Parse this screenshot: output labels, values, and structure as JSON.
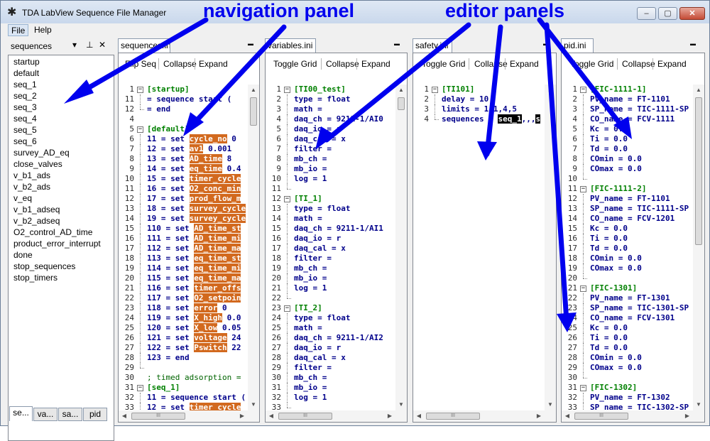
{
  "window": {
    "title": "TDA LabView Sequence File Manager",
    "min": "–",
    "max": "▢",
    "close": "✕"
  },
  "menu": {
    "file": "File",
    "help": "Help"
  },
  "nav": {
    "title": "sequences",
    "dropdown": "▾",
    "pin": "⊥",
    "close": "✕",
    "items": [
      "startup",
      "default",
      "seq_1",
      "seq_2",
      "seq_3",
      "seq_4",
      "seq_5",
      "seq_6",
      "survey_AD_eq",
      "close_valves",
      "v_b1_ads",
      "v_b2_ads",
      "v_eq",
      "v_b1_adseq",
      "v_b2_adseq",
      "O2_control_AD_time",
      "product_error_interrupt",
      "done",
      "stop_sequences",
      "stop_timers"
    ],
    "tabs": [
      "se...",
      "va...",
      "sa...",
      "pid"
    ]
  },
  "annotations": {
    "nav": "navigation panel",
    "editor": "editor panels"
  },
  "panels": [
    {
      "tab": "sequences.ini",
      "toolbar": [
        "Flip Seq",
        "Collapse",
        "Expand"
      ],
      "lines": [
        {
          "n": "1",
          "t": "[startup]",
          "f": "box",
          "h": true
        },
        {
          "n": "11",
          "t": "= sequence start (",
          "f": "line"
        },
        {
          "n": "12",
          "t": "= end",
          "f": "end"
        },
        {
          "n": "4",
          "t": "",
          "f": ""
        },
        {
          "n": "5",
          "t": "[default]",
          "f": "box",
          "h": true
        },
        {
          "n": "6",
          "t": "11 = set ",
          "hl": "cycle_no",
          " r": "",
          "tail": " 0",
          "f": "line"
        },
        {
          "n": "7",
          "t": "12 = set ",
          "hl": "av1",
          "tail": " 0.001",
          "f": "line"
        },
        {
          "n": "8",
          "t": "13 = set ",
          "hl": "AD_time",
          "tail": " 8",
          "f": "line"
        },
        {
          "n": "9",
          "t": "14 = set ",
          "hl": "eq_time",
          "tail": " 0.4",
          "f": "line"
        },
        {
          "n": "10",
          "t": "15 = set ",
          "hl": "timer_cycle",
          "tail": "",
          "f": "line"
        },
        {
          "n": "11",
          "t": "16 = set ",
          "hl": "O2_conc_min",
          "tail": "",
          "f": "line"
        },
        {
          "n": "12",
          "t": "17 = set ",
          "hl": "prod_flow_m",
          "tail": "",
          "f": "line"
        },
        {
          "n": "13",
          "t": "18 = set ",
          "hl": "survey_cycle",
          "tail": "",
          "f": "line"
        },
        {
          "n": "14",
          "t": "19 = set ",
          "hl": "survey_cycle",
          "tail": "",
          "f": "line"
        },
        {
          "n": "15",
          "t": "110 = set ",
          "hl": "AD_time_st",
          "tail": "",
          "f": "line"
        },
        {
          "n": "16",
          "t": "111 = set ",
          "hl": "AD_time_mi",
          "tail": "",
          "f": "line"
        },
        {
          "n": "17",
          "t": "112 = set ",
          "hl": "AD_time_ma",
          "tail": "",
          "f": "line"
        },
        {
          "n": "18",
          "t": "113 = set ",
          "hl": "eq_time_st",
          "tail": "",
          "f": "line"
        },
        {
          "n": "19",
          "t": "114 = set ",
          "hl": "eq_time_mi",
          "tail": "",
          "f": "line"
        },
        {
          "n": "20",
          "t": "115 = set ",
          "hl": "eq_time_ma",
          "tail": "",
          "f": "line"
        },
        {
          "n": "21",
          "t": "116 = set ",
          "hl": "timer_offs",
          "tail": "",
          "f": "line"
        },
        {
          "n": "22",
          "t": "117 = set ",
          "hl": "O2_setpoin",
          "tail": "",
          "f": "line"
        },
        {
          "n": "23",
          "t": "118 = set ",
          "hl": "error",
          "tail": " 0",
          "f": "line"
        },
        {
          "n": "24",
          "t": "119 = set ",
          "hl": "X_high",
          "tail": " 0.0",
          "f": "line"
        },
        {
          "n": "25",
          "t": "120 = set ",
          "hl": "X_low",
          "tail": " 0.05",
          "f": "line"
        },
        {
          "n": "26",
          "t": "121 = set ",
          "hl": "voltage",
          "tail": " 24",
          "f": "line"
        },
        {
          "n": "27",
          "t": "122 = set ",
          "hl": "Pswitch",
          "tail": " 22",
          "f": "line"
        },
        {
          "n": "28",
          "t": "123 = end",
          "f": "line"
        },
        {
          "n": "29",
          "t": "",
          "f": "end"
        },
        {
          "n": "30",
          "t": "; timed adsorption =",
          "f": "",
          "c": true
        },
        {
          "n": "31",
          "t": "[seq_1]",
          "f": "box",
          "h": true
        },
        {
          "n": "32",
          "t": "11 = sequence start (",
          "f": "line"
        },
        {
          "n": "33",
          "t": "12 = set ",
          "hl": "timer_cycle",
          "tail": "",
          "f": "line"
        }
      ]
    },
    {
      "tab": "variables.ini",
      "toolbar": [
        "Toggle Grid",
        "Collapse",
        "Expand"
      ],
      "lines": [
        {
          "n": "1",
          "t": "[TI00_test]",
          "f": "box",
          "h": true
        },
        {
          "n": "2",
          "t": "type = float",
          "f": "line"
        },
        {
          "n": "3",
          "t": "math =",
          "f": "line"
        },
        {
          "n": "4",
          "t": "daq_ch = 9211-1/AI0",
          "f": "line"
        },
        {
          "n": "5",
          "t": "daq_io = r",
          "f": "line"
        },
        {
          "n": "6",
          "t": "daq_cal = x",
          "f": "line"
        },
        {
          "n": "7",
          "t": "filter =",
          "f": "line"
        },
        {
          "n": "8",
          "t": "mb_ch =",
          "f": "line"
        },
        {
          "n": "9",
          "t": "mb_io =",
          "f": "line"
        },
        {
          "n": "10",
          "t": "log = 1",
          "f": "line"
        },
        {
          "n": "11",
          "t": "",
          "f": "end"
        },
        {
          "n": "12",
          "t": "[TI_1]",
          "f": "box",
          "h": true
        },
        {
          "n": "13",
          "t": "type = float",
          "f": "line"
        },
        {
          "n": "14",
          "t": "math =",
          "f": "line"
        },
        {
          "n": "15",
          "t": "daq_ch = 9211-1/AI1",
          "f": "line"
        },
        {
          "n": "16",
          "t": "daq_io = r",
          "f": "line"
        },
        {
          "n": "17",
          "t": "daq_cal = x",
          "f": "line"
        },
        {
          "n": "18",
          "t": "filter =",
          "f": "line"
        },
        {
          "n": "19",
          "t": "mb_ch =",
          "f": "line"
        },
        {
          "n": "20",
          "t": "mb_io =",
          "f": "line"
        },
        {
          "n": "21",
          "t": "log = 1",
          "f": "line"
        },
        {
          "n": "22",
          "t": "",
          "f": "end"
        },
        {
          "n": "23",
          "t": "[TI_2]",
          "f": "box",
          "h": true
        },
        {
          "n": "24",
          "t": "type = float",
          "f": "line"
        },
        {
          "n": "25",
          "t": "math =",
          "f": "line"
        },
        {
          "n": "26",
          "t": "daq_ch = 9211-1/AI2",
          "f": "line"
        },
        {
          "n": "27",
          "t": "daq_io = r",
          "f": "line"
        },
        {
          "n": "28",
          "t": "daq_cal = x",
          "f": "line"
        },
        {
          "n": "29",
          "t": "filter =",
          "f": "line"
        },
        {
          "n": "30",
          "t": "mb_ch =",
          "f": "line"
        },
        {
          "n": "31",
          "t": "mb_io =",
          "f": "line"
        },
        {
          "n": "32",
          "t": "log = 1",
          "f": "line"
        },
        {
          "n": "33",
          "t": "",
          "f": "end"
        }
      ]
    },
    {
      "tab": "safety.ini",
      "toolbar": [
        "Toggle Grid",
        "Collapse",
        "Expand"
      ],
      "lines": [
        {
          "n": "1",
          "t": "[TI101]",
          "f": "box",
          "h": true
        },
        {
          "n": "2",
          "t": "delay = 10",
          "f": "line"
        },
        {
          "n": "3",
          "t": "limits = 1,1,4,5",
          "f": "line"
        },
        {
          "n": "4",
          "t": "sequences = ",
          "sel": "seq_1",
          "tail": ",,,",
          "sel2": "s",
          "f": "end"
        }
      ]
    },
    {
      "tab": "pid.ini",
      "toolbar": [
        "Toggle Grid",
        "Collapse",
        "Expand"
      ],
      "lines": [
        {
          "n": "1",
          "t": "[FIC-1111-1]",
          "f": "box",
          "h": true
        },
        {
          "n": "2",
          "t": "PV_name = FT-1101",
          "f": "line"
        },
        {
          "n": "3",
          "t": "SP_name = TIC-1111-SP",
          "f": "line"
        },
        {
          "n": "4",
          "t": "CO_name = FCV-1111",
          "f": "line"
        },
        {
          "n": "5",
          "t": "Kc = 0.0",
          "f": "line"
        },
        {
          "n": "6",
          "t": "Ti = 0.0",
          "f": "line"
        },
        {
          "n": "7",
          "t": "Td = 0.0",
          "f": "line"
        },
        {
          "n": "8",
          "t": "COmin = 0.0",
          "f": "line"
        },
        {
          "n": "9",
          "t": "COmax = 0.0",
          "f": "line"
        },
        {
          "n": "10",
          "t": "",
          "f": "end"
        },
        {
          "n": "11",
          "t": "[FIC-1111-2]",
          "f": "box",
          "h": true
        },
        {
          "n": "12",
          "t": "PV_name = FT-1101",
          "f": "line"
        },
        {
          "n": "13",
          "t": "SP_name = TIC-1111-SP",
          "f": "line"
        },
        {
          "n": "14",
          "t": "CO_name = FCV-1201",
          "f": "line"
        },
        {
          "n": "15",
          "t": "Kc = 0.0",
          "f": "line"
        },
        {
          "n": "16",
          "t": "Ti = 0.0",
          "f": "line"
        },
        {
          "n": "17",
          "t": "Td = 0.0",
          "f": "line"
        },
        {
          "n": "18",
          "t": "COmin = 0.0",
          "f": "line"
        },
        {
          "n": "19",
          "t": "COmax = 0.0",
          "f": "line"
        },
        {
          "n": "20",
          "t": "",
          "f": "end"
        },
        {
          "n": "21",
          "t": "[FIC-1301]",
          "f": "box",
          "h": true
        },
        {
          "n": "22",
          "t": "PV_name = FT-1301",
          "f": "line"
        },
        {
          "n": "23",
          "t": "SP_name = TIC-1301-SP",
          "f": "line"
        },
        {
          "n": "24",
          "t": "CO_name = FCV-1301",
          "f": "line"
        },
        {
          "n": "25",
          "t": "Kc = 0.0",
          "f": "line"
        },
        {
          "n": "26",
          "t": "Ti = 0.0",
          "f": "line"
        },
        {
          "n": "27",
          "t": "Td = 0.0",
          "f": "line"
        },
        {
          "n": "28",
          "t": "COmin = 0.0",
          "f": "line"
        },
        {
          "n": "29",
          "t": "COmax = 0.0",
          "f": "line"
        },
        {
          "n": "30",
          "t": "",
          "f": "end"
        },
        {
          "n": "31",
          "t": "[FIC-1302]",
          "f": "box",
          "h": true
        },
        {
          "n": "32",
          "t": "PV_name = FT-1302",
          "f": "line"
        },
        {
          "n": "33",
          "t": "SP_name = TIC-1302-SP",
          "f": "line"
        }
      ]
    }
  ],
  "scroll": {
    "up": "▲",
    "down": "▼",
    "left": "◀",
    "right": "▶",
    "grip": "III"
  }
}
